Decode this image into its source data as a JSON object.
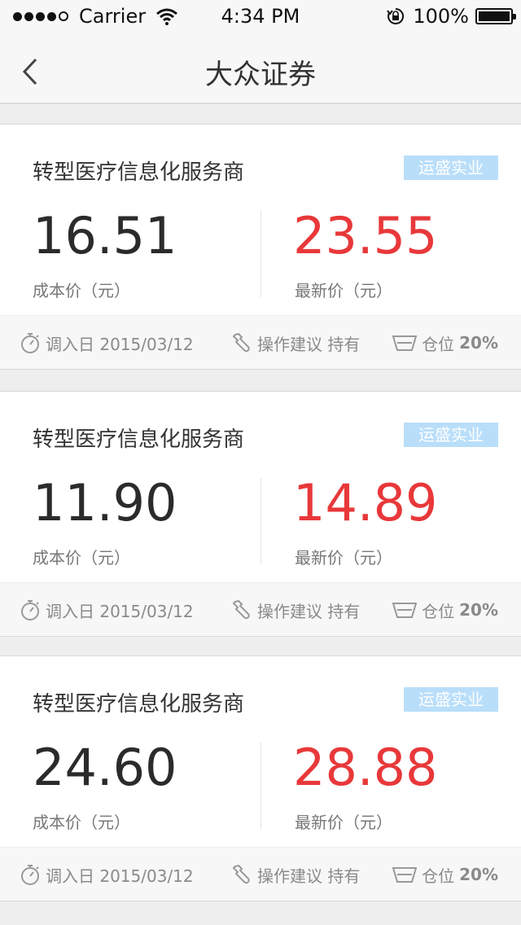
{
  "status_bar": {
    "carrier": "Carrier",
    "time": "4:34 PM",
    "battery": "100%"
  },
  "nav": {
    "title": "大众证券"
  },
  "cards": [
    {
      "title": "转型医疗信息化服务商",
      "tag": "运盛实业",
      "cost_price": "16.51",
      "cost_label": "成本价（元）",
      "latest_price": "23.55",
      "latest_label": "最新价（元）",
      "date_text": "调入日 2015/03/12",
      "advice_text": "操作建议 持有",
      "position_label": "仓位",
      "position_value": "20%"
    },
    {
      "title": "转型医疗信息化服务商",
      "tag": "运盛实业",
      "cost_price": "11.90",
      "cost_label": "成本价（元）",
      "latest_price": "14.89",
      "latest_label": "最新价（元）",
      "date_text": "调入日 2015/03/12",
      "advice_text": "操作建议 持有",
      "position_label": "仓位",
      "position_value": "20%"
    },
    {
      "title": "转型医疗信息化服务商",
      "tag": "运盛实业",
      "cost_price": "24.60",
      "cost_label": "成本价（元）",
      "latest_price": "28.88",
      "latest_label": "最新价（元）",
      "date_text": "调入日 2015/03/12",
      "advice_text": "操作建议 持有",
      "position_label": "仓位",
      "position_value": "20%"
    }
  ],
  "colors": {
    "latest_price": "#e8383a",
    "tag_bg": "#b9defa"
  },
  "icons": [
    "signal-dots-icon",
    "wifi-icon",
    "rotation-lock-icon",
    "battery-icon",
    "back-chevron-icon",
    "stopwatch-icon",
    "wrench-icon",
    "basket-icon"
  ]
}
